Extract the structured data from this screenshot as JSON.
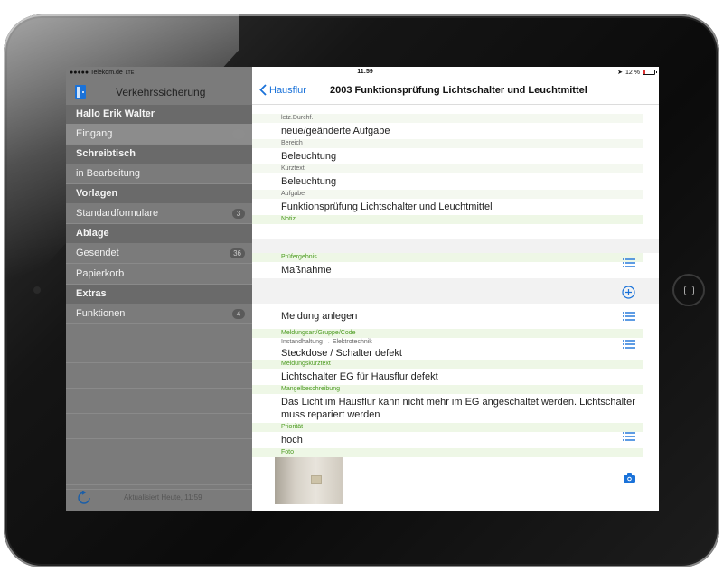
{
  "status": {
    "carrier": "●●●●● Telekom.de",
    "network": "LTE",
    "time": "11:59",
    "battery": "12 %"
  },
  "sidebar": {
    "title": "Verkehrssicherung",
    "greeting": "Hallo Erik Walter",
    "sections": [
      {
        "label": "Schreibtisch"
      },
      {
        "label": "Vorlagen"
      },
      {
        "label": "Ablage"
      },
      {
        "label": "Extras"
      }
    ],
    "items": {
      "eingang": {
        "label": "Eingang",
        "badge": ""
      },
      "in_bearbeitung": {
        "label": "in Bearbeitung"
      },
      "standardformulare": {
        "label": "Standardformulare",
        "badge": "3"
      },
      "gesendet": {
        "label": "Gesendet",
        "badge": "36"
      },
      "papierkorb": {
        "label": "Papierkorb"
      },
      "funktionen": {
        "label": "Funktionen",
        "badge": "4"
      }
    },
    "footer_updated": "Aktualisiert Heute, 11:59"
  },
  "navbar": {
    "back_label": "Hausflur",
    "title": "2003 Funktionsprüfung Lichtschalter und Leuchtmittel"
  },
  "form": {
    "letzte_label": "letz.Durchf.",
    "letzte_value": "neue/geänderte Aufgabe",
    "bereich_label": "Bereich",
    "bereich_value": "Beleuchtung",
    "kurztext_label": "Kurztext",
    "kurztext_value": "Beleuchtung",
    "aufgabe_label": "Aufgabe",
    "aufgabe_value": "Funktionsprüfung Lichtschalter und Leuchtmittel",
    "notiz_label": "Notiz",
    "pruefergebnis_label": "Prüfergebnis",
    "pruefergebnis_value": "Maßnahme",
    "meldung_anlegen": "Meldung anlegen",
    "meldungsart_label": "Meldungsart/Gruppe/Code",
    "meldungsart_path": "Instandhaltung → Elektrotechnik",
    "meldungsart_value": "Steckdose / Schalter defekt",
    "meldungskurztext_label": "Meldungskurztext",
    "meldungskurztext_value": "Lichtschalter EG für Hausflur defekt",
    "mangel_label": "Mangelbeschreibung",
    "mangel_value": "Das Licht im Hausflur kann nicht mehr im EG angeschaltet werden. Lichtschalter muss repariert werden",
    "prioritaet_label": "Priorität",
    "prioritaet_value": "hoch",
    "foto_label": "Foto"
  },
  "colors": {
    "accent": "#1a72d9",
    "label_green": "#4a9a1e",
    "sidebar_bg": "#7b7b7b"
  },
  "icons": {
    "list": "list-icon",
    "plus": "plus-circle-icon",
    "camera": "camera-icon",
    "refresh": "refresh-icon",
    "back": "chevron-left-icon"
  }
}
